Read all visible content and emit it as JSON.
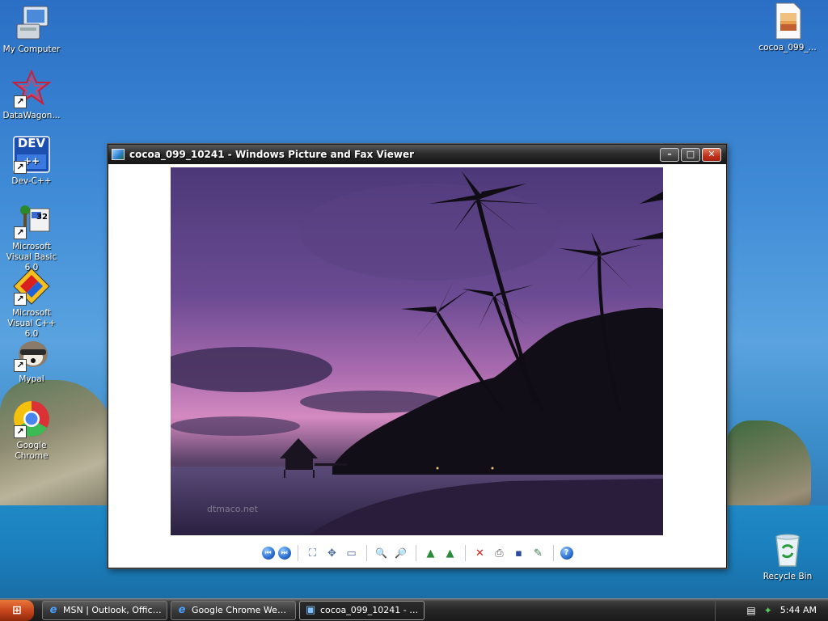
{
  "desktop": {
    "icons_left": [
      {
        "label": "My Computer",
        "icon": "computer-icon"
      },
      {
        "label": "DataWagon...",
        "icon": "datawagon-icon"
      },
      {
        "label": "Dev-C++",
        "icon": "devcpp-icon",
        "badge": "DEV"
      },
      {
        "label": "Microsoft Visual Basic 6.0",
        "icon": "visual-basic-icon",
        "badge": "32"
      },
      {
        "label": "Microsoft Visual C++ 6.0",
        "icon": "visual-cpp-icon"
      },
      {
        "label": "Mypal",
        "icon": "mypal-icon"
      },
      {
        "label": "Google Chrome",
        "icon": "chrome-icon"
      }
    ],
    "icons_right": [
      {
        "label": "cocoa_099_...",
        "icon": "image-file-icon"
      },
      {
        "label": "Recycle Bin",
        "icon": "recycle-bin-icon"
      }
    ]
  },
  "window": {
    "title": "cocoa_099_10241 - Windows Picture and Fax Viewer",
    "minimize": "–",
    "maximize": "□",
    "close": "✕",
    "watermark": "dtmaco.net",
    "toolbar": [
      {
        "name": "previous-image-button",
        "glyph": "⏮"
      },
      {
        "name": "next-image-button",
        "glyph": "⏭"
      },
      {
        "name": "best-fit-button",
        "glyph": "⛶"
      },
      {
        "name": "actual-size-button",
        "glyph": "✥"
      },
      {
        "name": "slide-show-button",
        "glyph": "▭"
      },
      {
        "name": "zoom-in-button",
        "glyph": "🔍"
      },
      {
        "name": "zoom-out-button",
        "glyph": "🔎"
      },
      {
        "name": "rotate-clockwise-button",
        "glyph": "▲"
      },
      {
        "name": "rotate-counterclockwise-button",
        "glyph": "▲"
      },
      {
        "name": "delete-button",
        "glyph": "✕"
      },
      {
        "name": "print-button",
        "glyph": "⎙"
      },
      {
        "name": "copy-to-button",
        "glyph": "▪"
      },
      {
        "name": "edit-button",
        "glyph": "✎"
      },
      {
        "name": "help-button",
        "glyph": "?"
      }
    ],
    "colors": {
      "delete": "#cc2222",
      "rotate": "#2a8a3a",
      "nav": "#2b6fd0"
    }
  },
  "taskbar": {
    "start_glyph": "⊞",
    "tasks": [
      {
        "label": "MSN | Outlook, Office,...",
        "icon": "ie-icon",
        "glyph": "e",
        "active": false
      },
      {
        "label": "Google Chrome Web B...",
        "icon": "ie-icon",
        "glyph": "e",
        "active": false
      },
      {
        "label": "cocoa_099_10241 - W...",
        "icon": "picture-viewer-icon",
        "glyph": "▣",
        "active": true
      }
    ],
    "tray": {
      "keyboard": "▤",
      "network": "✦",
      "time": "5:44 AM"
    }
  }
}
